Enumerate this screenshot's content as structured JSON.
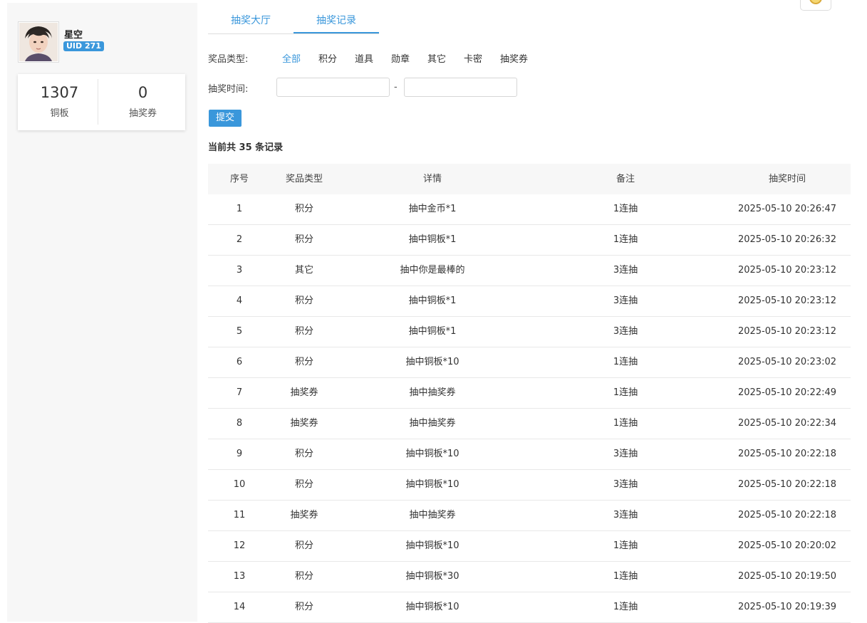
{
  "user": {
    "name": "星空",
    "uid": "UID 271"
  },
  "stats": [
    {
      "value": "1307",
      "label": "铜板"
    },
    {
      "value": "0",
      "label": "抽奖券"
    }
  ],
  "tabs": [
    {
      "label": "抽奖大厅",
      "active": false
    },
    {
      "label": "抽奖记录",
      "active": true
    }
  ],
  "filter": {
    "type_label": "奖品类型:",
    "types": [
      "全部",
      "积分",
      "道具",
      "勋章",
      "其它",
      "卡密",
      "抽奖券"
    ],
    "active_type": "全部",
    "time_label": "抽奖时间:",
    "date_start": "",
    "date_end": "",
    "separator": "-",
    "submit_label": "提交"
  },
  "summary": "当前共 35 条记录",
  "table": {
    "headers": [
      "序号",
      "奖品类型",
      "详情",
      "备注",
      "抽奖时间"
    ],
    "rows": [
      [
        "1",
        "积分",
        "抽中金币*1",
        "1连抽",
        "2025-05-10 20:26:47"
      ],
      [
        "2",
        "积分",
        "抽中铜板*1",
        "1连抽",
        "2025-05-10 20:26:32"
      ],
      [
        "3",
        "其它",
        "抽中你是最棒的",
        "3连抽",
        "2025-05-10 20:23:12"
      ],
      [
        "4",
        "积分",
        "抽中铜板*1",
        "3连抽",
        "2025-05-10 20:23:12"
      ],
      [
        "5",
        "积分",
        "抽中铜板*1",
        "3连抽",
        "2025-05-10 20:23:12"
      ],
      [
        "6",
        "积分",
        "抽中铜板*10",
        "1连抽",
        "2025-05-10 20:23:02"
      ],
      [
        "7",
        "抽奖券",
        "抽中抽奖券",
        "1连抽",
        "2025-05-10 20:22:49"
      ],
      [
        "8",
        "抽奖券",
        "抽中抽奖券",
        "1连抽",
        "2025-05-10 20:22:34"
      ],
      [
        "9",
        "积分",
        "抽中铜板*10",
        "3连抽",
        "2025-05-10 20:22:18"
      ],
      [
        "10",
        "积分",
        "抽中铜板*10",
        "3连抽",
        "2025-05-10 20:22:18"
      ],
      [
        "11",
        "抽奖券",
        "抽中抽奖券",
        "3连抽",
        "2025-05-10 20:22:18"
      ],
      [
        "12",
        "积分",
        "抽中铜板*10",
        "1连抽",
        "2025-05-10 20:20:02"
      ],
      [
        "13",
        "积分",
        "抽中铜板*30",
        "1连抽",
        "2025-05-10 20:19:50"
      ],
      [
        "14",
        "积分",
        "抽中铜板*10",
        "1连抽",
        "2025-05-10 20:19:39"
      ]
    ]
  },
  "icons": {
    "avatar": "user-avatar-photo",
    "corner": "coin-icon"
  },
  "colors": {
    "accent": "#3a97db",
    "sidebar_bg": "#f7f7f7"
  }
}
